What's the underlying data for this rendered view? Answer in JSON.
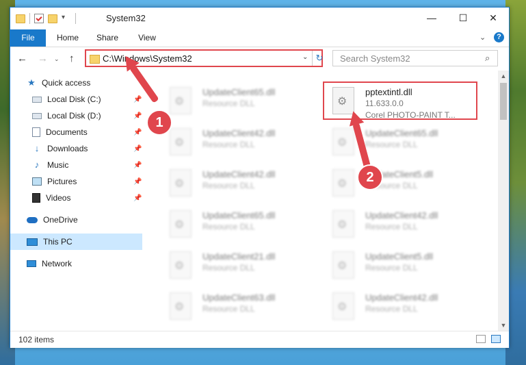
{
  "window": {
    "title": "System32",
    "controls": {
      "minimize": "—",
      "maximize": "☐",
      "close": "✕"
    }
  },
  "ribbon": {
    "tabs": [
      "File",
      "Home",
      "Share",
      "View"
    ],
    "collapse_icon": "chevron-down-icon",
    "help": "?"
  },
  "navigation": {
    "back": "←",
    "forward": "→",
    "recent": "⌄",
    "up": "↑",
    "address": "C:\\Windows\\System32",
    "address_dropdown": "⌄",
    "refresh": "↻",
    "search_placeholder": "Search System32",
    "search_icon": "⌕"
  },
  "sidebar": {
    "pin_glyph": "📌",
    "items": [
      {
        "label": "Quick access",
        "icon": "star-icon",
        "pinned": false,
        "selected": false
      },
      {
        "label": "Local Disk (C:)",
        "icon": "drive-icon",
        "pinned": true,
        "selected": false
      },
      {
        "label": "Local Disk (D:)",
        "icon": "drive-icon",
        "pinned": true,
        "selected": false
      },
      {
        "label": "Documents",
        "icon": "documents-icon",
        "pinned": true,
        "selected": false
      },
      {
        "label": "Downloads",
        "icon": "download-icon",
        "pinned": true,
        "selected": false
      },
      {
        "label": "Music",
        "icon": "music-icon",
        "pinned": true,
        "selected": false
      },
      {
        "label": "Pictures",
        "icon": "pictures-icon",
        "pinned": true,
        "selected": false
      },
      {
        "label": "Videos",
        "icon": "videos-icon",
        "pinned": true,
        "selected": false
      },
      {
        "label": "OneDrive",
        "icon": "onedrive-icon",
        "pinned": false,
        "selected": false
      },
      {
        "label": "This PC",
        "icon": "this-pc-icon",
        "pinned": false,
        "selected": true
      },
      {
        "label": "Network",
        "icon": "network-icon",
        "pinned": false,
        "selected": false
      }
    ]
  },
  "files": {
    "highlighted": {
      "name": "pptextintl.dll",
      "version": "11.633.0.0",
      "description": "Corel PHOTO-PAINT T..."
    },
    "blurred_left": [
      {
        "name": "UpdateClient65.dll",
        "type": "Resource DLL"
      },
      {
        "name": "UpdateClient42.dll",
        "type": "Resource DLL"
      },
      {
        "name": "UpdateClient42.dll",
        "type": "Resource DLL"
      },
      {
        "name": "UpdateClient65.dll",
        "type": "Resource DLL"
      },
      {
        "name": "UpdateClient21.dll",
        "type": "Resource DLL"
      },
      {
        "name": "UpdateClient63.dll",
        "type": "Resource DLL"
      }
    ],
    "blurred_right": [
      {
        "name": "UpdateClient65.dll",
        "type": "Resource DLL"
      },
      {
        "name": "UpdateClient5.dll",
        "type": "Resource DLL"
      },
      {
        "name": "UpdateClient42.dll",
        "type": "Resource DLL"
      },
      {
        "name": "UpdateClient5.dll",
        "type": "Resource DLL"
      },
      {
        "name": "UpdateClient42.dll",
        "type": "Resource DLL"
      }
    ]
  },
  "status": {
    "items": "102 items"
  },
  "annotations": {
    "step1": "1",
    "step2": "2",
    "color": "#e0464d"
  },
  "colors": {
    "accent": "#1979ca",
    "selection": "#cce8ff",
    "highlight": "#e0464d"
  }
}
